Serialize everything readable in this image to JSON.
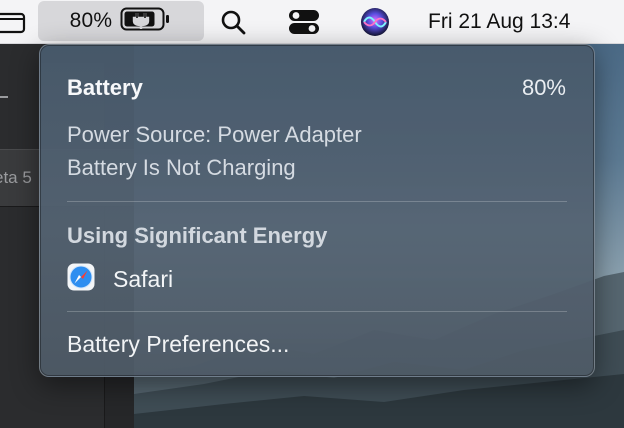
{
  "menubar": {
    "battery_percent": "80%",
    "clock": "Fri 21 Aug  13:4"
  },
  "background": {
    "tab_text": "eta 5"
  },
  "popover": {
    "title": "Battery",
    "percent": "80%",
    "power_source": "Power Source: Power Adapter",
    "charging_status": "Battery Is Not Charging",
    "energy_section_title": "Using Significant Energy",
    "apps": [
      {
        "name": "Safari",
        "icon": "safari-icon"
      }
    ],
    "preferences_label": "Battery Preferences..."
  },
  "colors": {
    "menubar_bg": "#f4f4f6",
    "popover_bg": "#4e6074",
    "battery_highlight": "#d7d7da"
  }
}
